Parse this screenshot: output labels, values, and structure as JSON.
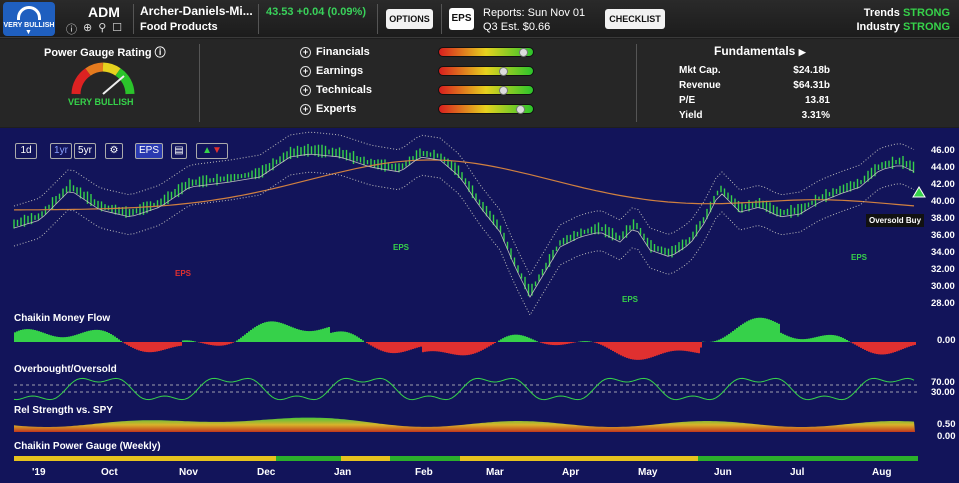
{
  "header": {
    "rating_badge": "VERY BULLISH",
    "ticker": "ADM",
    "company_name": "Archer-Daniels-Mi...",
    "industry": "Food Products",
    "price_line": "43.53 +0.04 (0.09%)",
    "options_label": "OPTIONS",
    "eps_label": "EPS",
    "reports_line1": "Reports: Sun Nov 01",
    "reports_line2": "Q3  Est.  $0.66",
    "checklist_label": "CHECKLIST",
    "trends_label": "Trends",
    "trends_value": "STRONG",
    "industry_label": "Industry",
    "industry_value": "STRONG"
  },
  "power_gauge": {
    "title": "Power Gauge Rating",
    "rating": "VERY BULLISH",
    "metrics": [
      {
        "label": "Financials",
        "level": 0.93
      },
      {
        "label": "Earnings",
        "level": 0.7
      },
      {
        "label": "Technicals",
        "level": 0.7
      },
      {
        "label": "Experts",
        "level": 0.9
      }
    ]
  },
  "fundamentals": {
    "title": "Fundamentals",
    "rows": [
      {
        "label": "Mkt Cap.",
        "value": "$24.18b"
      },
      {
        "label": "Revenue",
        "value": "$64.31b"
      },
      {
        "label": "P/E",
        "value": "13.81"
      },
      {
        "label": "Yield",
        "value": "3.31%"
      }
    ]
  },
  "toolbar": {
    "btn_1d": "1d",
    "btn_1yr": "1yr",
    "btn_5yr": "5yr",
    "btn_eps": "EPS"
  },
  "chart_data": {
    "type": "line",
    "price_axis": [
      "46.00",
      "44.00",
      "42.00",
      "40.00",
      "38.00",
      "36.00",
      "34.00",
      "32.00",
      "30.00",
      "28.00"
    ],
    "x_labels": [
      "'19",
      "Oct",
      "Nov",
      "Dec",
      "Jan",
      "Feb",
      "Mar",
      "Apr",
      "May",
      "Jun",
      "Jul",
      "Aug"
    ],
    "eps_markers": [
      {
        "label": "EPS",
        "color": "#e03030"
      },
      {
        "label": "EPS",
        "color": "#36d14a"
      },
      {
        "label": "EPS",
        "color": "#36d14a"
      },
      {
        "label": "EPS",
        "color": "#36d14a"
      }
    ],
    "oversold_tip": "Oversold Buy",
    "money_flow_title": "Chaikin Money Flow",
    "money_flow_axis": "0.00",
    "obos_title": "Overbought/Oversold",
    "obos_axis": [
      "70.00",
      "30.00"
    ],
    "rel_strength_title": "Rel Strength vs. SPY",
    "rel_strength_axis": [
      "0.50",
      "0.00"
    ],
    "power_gauge_weekly_title": "Chaikin Power Gauge (Weekly)",
    "colors": {
      "up": "#36d14a",
      "down": "#e03030",
      "background": "#12145a",
      "sma": "#d08040"
    }
  }
}
